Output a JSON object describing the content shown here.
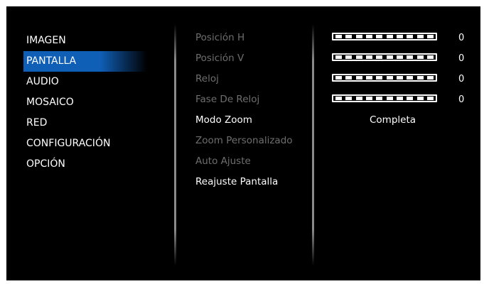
{
  "main_menu": {
    "items": [
      {
        "label": "IMAGEN",
        "selected": false
      },
      {
        "label": "PANTALLA",
        "selected": true
      },
      {
        "label": "AUDIO",
        "selected": false
      },
      {
        "label": "MOSAICO",
        "selected": false
      },
      {
        "label": "RED",
        "selected": false
      },
      {
        "label": "CONFIGURACIÓN",
        "selected": false
      },
      {
        "label": "OPCIÓN",
        "selected": false
      }
    ],
    "highlight_color": "#0f5fb7"
  },
  "submenu": {
    "items": [
      {
        "label": "Posición H",
        "enabled": false
      },
      {
        "label": "Posición V",
        "enabled": false
      },
      {
        "label": "Reloj",
        "enabled": false
      },
      {
        "label": "Fase De Reloj",
        "enabled": false
      },
      {
        "label": "Modo Zoom",
        "enabled": true
      },
      {
        "label": "Zoom Personalizado",
        "enabled": false
      },
      {
        "label": "Auto Ajuste",
        "enabled": false
      },
      {
        "label": "Reajuste Pantalla",
        "enabled": true
      }
    ],
    "disabled_color": "#6e6e6e"
  },
  "values": {
    "sliders": [
      {
        "value": "0",
        "fill": 0
      },
      {
        "value": "0",
        "fill": 0
      },
      {
        "value": "0",
        "fill": 0
      },
      {
        "value": "0",
        "fill": 0
      }
    ],
    "zoom_mode": "Completa"
  }
}
